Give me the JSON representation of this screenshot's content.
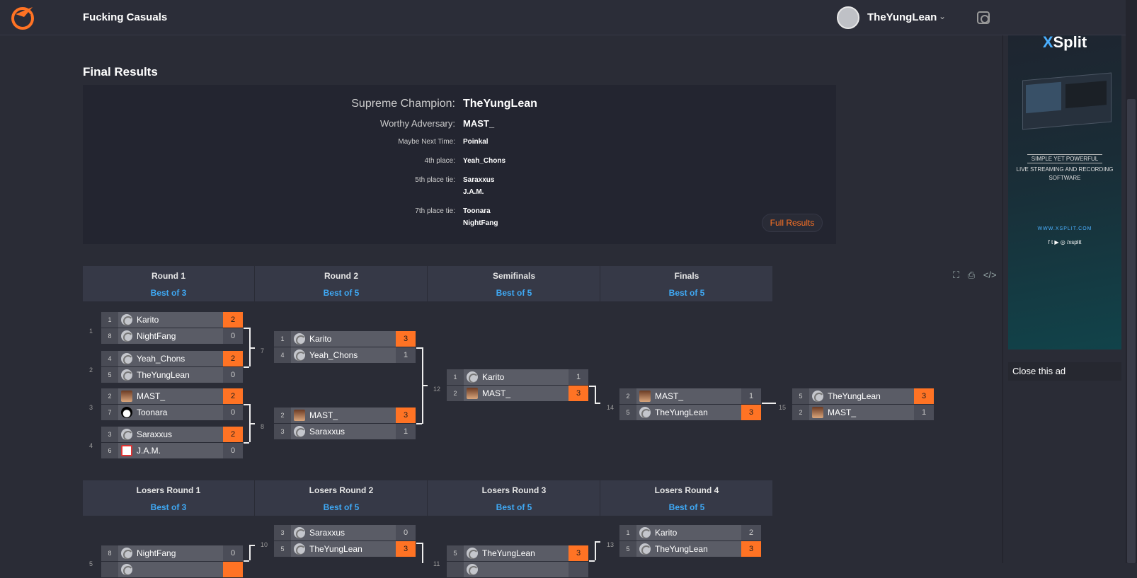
{
  "topbar": {
    "tournament": "Fucking Casuals",
    "username": "TheYungLean"
  },
  "results": {
    "heading": "Final Results",
    "rows": [
      {
        "label": "Supreme Champion:",
        "names": [
          "TheYungLean"
        ]
      },
      {
        "label": "Worthy Adversary:",
        "names": [
          "MAST_"
        ]
      },
      {
        "label": "Maybe Next Time:",
        "names": [
          "Poinkal"
        ]
      },
      {
        "label": "4th place:",
        "names": [
          "Yeah_Chons"
        ]
      },
      {
        "label": "5th place tie:",
        "names": [
          "Saraxxus",
          "J.A.M."
        ]
      },
      {
        "label": "7th place tie:",
        "names": [
          "Toonara",
          "NightFang"
        ]
      }
    ],
    "full_results": "Full Results"
  },
  "winners_headers": [
    {
      "name": "Round 1",
      "bo": "Best of 3"
    },
    {
      "name": "Round 2",
      "bo": "Best of 5"
    },
    {
      "name": "Semifinals",
      "bo": "Best of 5"
    },
    {
      "name": "Finals",
      "bo": "Best of 5"
    }
  ],
  "losers_headers": [
    {
      "name": "Losers Round 1",
      "bo": "Best of 3"
    },
    {
      "name": "Losers Round 2",
      "bo": "Best of 5"
    },
    {
      "name": "Losers Round 3",
      "bo": "Best of 5"
    },
    {
      "name": "Losers Round 4",
      "bo": "Best of 5"
    }
  ],
  "matches": [
    {
      "num": "1",
      "players": [
        {
          "seed": "1",
          "name": "Karito",
          "score": "2",
          "win": true,
          "avatar": "brand"
        },
        {
          "seed": "8",
          "name": "NightFang",
          "score": "0",
          "win": false,
          "avatar": "brand"
        }
      ]
    },
    {
      "num": "2",
      "players": [
        {
          "seed": "4",
          "name": "Yeah_Chons",
          "score": "2",
          "win": true,
          "avatar": "brand"
        },
        {
          "seed": "5",
          "name": "TheYungLean",
          "score": "0",
          "win": false,
          "avatar": "brand"
        }
      ]
    },
    {
      "num": "3",
      "players": [
        {
          "seed": "2",
          "name": "MAST_",
          "score": "2",
          "win": true,
          "avatar": "photo"
        },
        {
          "seed": "7",
          "name": "Toonara",
          "score": "0",
          "win": false,
          "avatar": "bw"
        }
      ]
    },
    {
      "num": "4",
      "players": [
        {
          "seed": "3",
          "name": "Saraxxus",
          "score": "2",
          "win": true,
          "avatar": "brand"
        },
        {
          "seed": "6",
          "name": "J.A.M.",
          "score": "0",
          "win": false,
          "avatar": "red"
        }
      ]
    },
    {
      "num": "7",
      "players": [
        {
          "seed": "1",
          "name": "Karito",
          "score": "3",
          "win": true,
          "avatar": "brand"
        },
        {
          "seed": "4",
          "name": "Yeah_Chons",
          "score": "1",
          "win": false,
          "avatar": "brand"
        }
      ]
    },
    {
      "num": "8",
      "players": [
        {
          "seed": "2",
          "name": "MAST_",
          "score": "3",
          "win": true,
          "avatar": "photo"
        },
        {
          "seed": "3",
          "name": "Saraxxus",
          "score": "1",
          "win": false,
          "avatar": "brand"
        }
      ]
    },
    {
      "num": "12",
      "players": [
        {
          "seed": "1",
          "name": "Karito",
          "score": "1",
          "win": false,
          "avatar": "brand"
        },
        {
          "seed": "2",
          "name": "MAST_",
          "score": "3",
          "win": true,
          "avatar": "photo"
        }
      ]
    },
    {
      "num": "14",
      "players": [
        {
          "seed": "2",
          "name": "MAST_",
          "score": "1",
          "win": false,
          "avatar": "photo"
        },
        {
          "seed": "5",
          "name": "TheYungLean",
          "score": "3",
          "win": true,
          "avatar": "brand"
        }
      ]
    },
    {
      "num": "15",
      "players": [
        {
          "seed": "5",
          "name": "TheYungLean",
          "score": "3",
          "win": true,
          "avatar": "brand"
        },
        {
          "seed": "2",
          "name": "MAST_",
          "score": "1",
          "win": false,
          "avatar": "photo"
        }
      ]
    },
    {
      "num": "5",
      "players": [
        {
          "seed": "8",
          "name": "NightFang",
          "score": "0",
          "win": false,
          "avatar": "brand"
        },
        {
          "seed": "",
          "name": "",
          "score": "",
          "win": true,
          "avatar": "brand"
        }
      ]
    },
    {
      "num": "10",
      "players": [
        {
          "seed": "3",
          "name": "Saraxxus",
          "score": "0",
          "win": false,
          "avatar": "brand"
        },
        {
          "seed": "5",
          "name": "TheYungLean",
          "score": "3",
          "win": true,
          "avatar": "brand"
        }
      ]
    },
    {
      "num": "11",
      "players": [
        {
          "seed": "5",
          "name": "TheYungLean",
          "score": "3",
          "win": true,
          "avatar": "brand"
        },
        {
          "seed": "",
          "name": "",
          "score": "",
          "win": false,
          "avatar": "brand"
        }
      ]
    },
    {
      "num": "13",
      "players": [
        {
          "seed": "1",
          "name": "Karito",
          "score": "2",
          "win": false,
          "avatar": "brand"
        },
        {
          "seed": "5",
          "name": "TheYungLean",
          "score": "3",
          "win": true,
          "avatar": "brand"
        }
      ]
    }
  ],
  "ad": {
    "brand": "Split",
    "brand_prefix": "X",
    "tagline": "SIMPLE YET POWERFUL",
    "tagline2": "LIVE STREAMING AND RECORDING SOFTWARE",
    "url": "WWW.XSPLIT.COM",
    "social": "f  t  ▶  ◎  /xsplit",
    "close": "Close this ad"
  },
  "colors": {
    "accent": "#ff7324",
    "link": "#3fa9f5",
    "bg": "#2a2c36"
  }
}
